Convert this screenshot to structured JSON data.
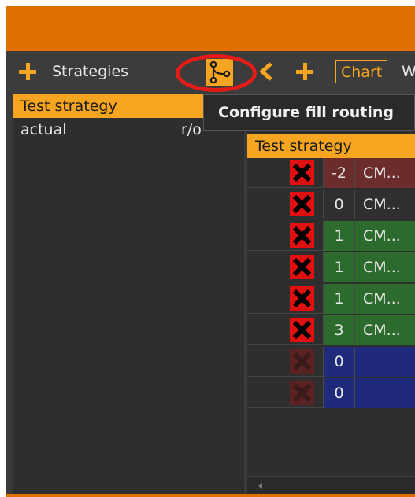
{
  "toolbar": {
    "strategies_label": "Strategies",
    "chart_button": "Chart",
    "cut_letter": "W",
    "accent_color": "#f6a521"
  },
  "tooltip": {
    "text": "Configure fill routing"
  },
  "strategy_list": {
    "items": [
      {
        "name": "Test strategy",
        "tag": ""
      },
      {
        "name": "actual",
        "tag": "r/o"
      }
    ]
  },
  "grid": {
    "header": "Test strategy",
    "rows": [
      {
        "qty": "-2",
        "instrument": "CM...",
        "state": "negative",
        "row_color": "#6b2c2c",
        "x_active": true
      },
      {
        "qty": "0",
        "instrument": "CM...",
        "state": "flat",
        "row_color": "#2f2f2f",
        "x_active": true
      },
      {
        "qty": "1",
        "instrument": "CM...",
        "state": "positive",
        "row_color": "#2d6a2d",
        "x_active": true
      },
      {
        "qty": "1",
        "instrument": "CM...",
        "state": "positive",
        "row_color": "#2d6a2d",
        "x_active": true
      },
      {
        "qty": "1",
        "instrument": "CM...",
        "state": "positive",
        "row_color": "#2d6a2d",
        "x_active": true
      },
      {
        "qty": "3",
        "instrument": "CM...",
        "state": "positive",
        "row_color": "#2d6a2d",
        "x_active": true
      },
      {
        "qty": "0",
        "instrument": "",
        "state": "pending",
        "row_color": "#1f2a7a",
        "x_active": false
      },
      {
        "qty": "0",
        "instrument": "",
        "state": "pending",
        "row_color": "#1f2a7a",
        "x_active": false
      }
    ]
  },
  "icons": {
    "add": "plus-icon",
    "routing": "fill-routing-icon",
    "back": "chevron-left-icon",
    "remove": "close-x-icon"
  }
}
